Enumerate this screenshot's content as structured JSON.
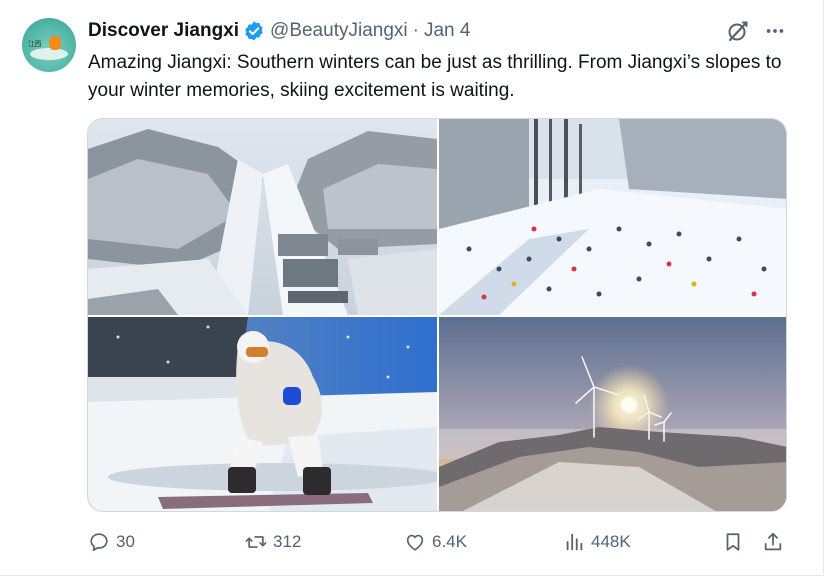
{
  "author": {
    "display_name": "Discover Jiangxi",
    "handle": "@BeautyJiangxi",
    "separator": "·",
    "date": "Jan 4",
    "avatar_icon": "discover-jiangxi-logo",
    "verified_color": "#1d9bf0"
  },
  "tweet": {
    "text": "Amazing Jiangxi: Southern winters can be just as thrilling. From Jiangxi’s slopes to your winter memories, skiing excitement is waiting."
  },
  "media": {
    "count": 4
  },
  "actions": {
    "replies": "30",
    "reposts": "312",
    "likes": "6.4K",
    "views": "448K"
  },
  "colors": {
    "text_primary": "#0f1419",
    "text_secondary": "#536471",
    "border": "#cfd9de"
  }
}
